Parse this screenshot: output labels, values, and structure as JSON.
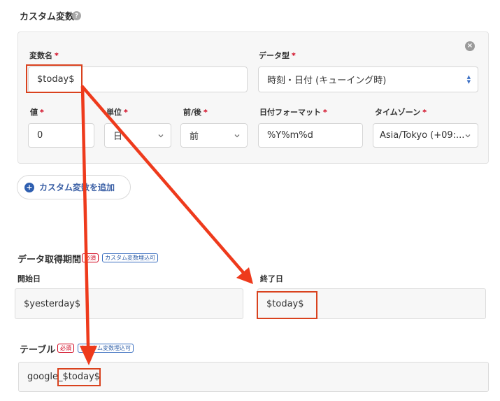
{
  "custom_vars": {
    "title": "カスタム変数",
    "help_icon": "?",
    "close_icon": "×",
    "var_name": {
      "label": "変数名",
      "required": "*",
      "value": "$today$"
    },
    "data_type": {
      "label": "データ型",
      "required": "*",
      "value": "時刻・日付 (キューイング時)",
      "arrows_up": "▲",
      "arrows_down": "▼"
    },
    "amount": {
      "label": "値",
      "required": "*",
      "value": "0"
    },
    "unit": {
      "label": "単位",
      "required": "*",
      "value": "日"
    },
    "before_after": {
      "label": "前/後",
      "required": "*",
      "value": "前"
    },
    "date_format": {
      "label": "日付フォーマット",
      "required": "*",
      "value": "%Y%m%d"
    },
    "timezone": {
      "label": "タイムゾーン",
      "required": "*",
      "value": "Asia/Tokyo (+09:..."
    },
    "add_button": {
      "icon": "+",
      "label": "カスタム変数を追加"
    }
  },
  "period": {
    "title": "データ取得期間",
    "badge_required": "必須",
    "badge_custom": "カスタム変数埋込可",
    "start": {
      "label": "開始日",
      "value": "$yesterday$"
    },
    "end": {
      "label": "終了日",
      "value": "$today$"
    }
  },
  "table": {
    "title": "テーブル",
    "badge_required": "必須",
    "badge_custom": "カスタム変数埋込可",
    "value_prefix": "google_",
    "value_var": "$today$"
  },
  "colors": {
    "annotation": "#ee3a1c",
    "required": "#d0021b",
    "accent": "#2f5fb0"
  },
  "icons": {
    "help": "question-circle-icon",
    "close": "close-circle-icon",
    "select": "chevron-down-icon",
    "native_select": "up-down-arrows-icon",
    "add": "plus-circle-icon"
  }
}
